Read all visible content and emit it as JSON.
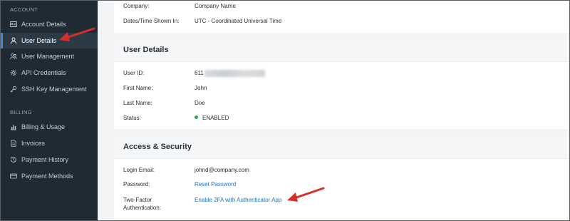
{
  "sidebar": {
    "sections": [
      {
        "title": "ACCOUNT",
        "items": [
          {
            "label": "Account Details",
            "icon": "id-card-icon"
          },
          {
            "label": "User Details",
            "icon": "user-icon",
            "active": true
          },
          {
            "label": "User Management",
            "icon": "users-icon"
          },
          {
            "label": "API Credentials",
            "icon": "gear-icon"
          },
          {
            "label": "SSH Key Management",
            "icon": "key-icon"
          }
        ]
      },
      {
        "title": "BILLING",
        "items": [
          {
            "label": "Billing & Usage",
            "icon": "bar-chart-icon"
          },
          {
            "label": "Invoices",
            "icon": "document-icon"
          },
          {
            "label": "Payment History",
            "icon": "history-icon"
          },
          {
            "label": "Payment Methods",
            "icon": "credit-card-icon"
          }
        ]
      }
    ]
  },
  "top_card": {
    "rows": [
      {
        "label": "Company:",
        "value": "Company Name"
      },
      {
        "label": "Dates/Time Shown In:",
        "value": "UTC - Coordinated Universal Time"
      }
    ]
  },
  "user_details": {
    "title": "User Details",
    "user_id_label": "User ID:",
    "user_id_visible": "611",
    "first_name_label": "First Name:",
    "first_name": "John",
    "last_name_label": "Last Name:",
    "last_name": "Doe",
    "status_label": "Status:",
    "status": "ENABLED",
    "status_color": "#2ea44f"
  },
  "access_security": {
    "title": "Access & Security",
    "login_email_label": "Login Email:",
    "login_email": "johnd@company.com",
    "password_label": "Password:",
    "password_link": "Reset Password",
    "two_factor_label_1": "Two-Factor",
    "two_factor_label_2": "Authentication:",
    "two_factor_link": "Enable 2FA with Authenticator App"
  },
  "colors": {
    "sidebar_bg": "#1f2a33",
    "active_accent": "#3f87d6",
    "link": "#1e73be",
    "annotation_arrow": "#d62f2a"
  }
}
